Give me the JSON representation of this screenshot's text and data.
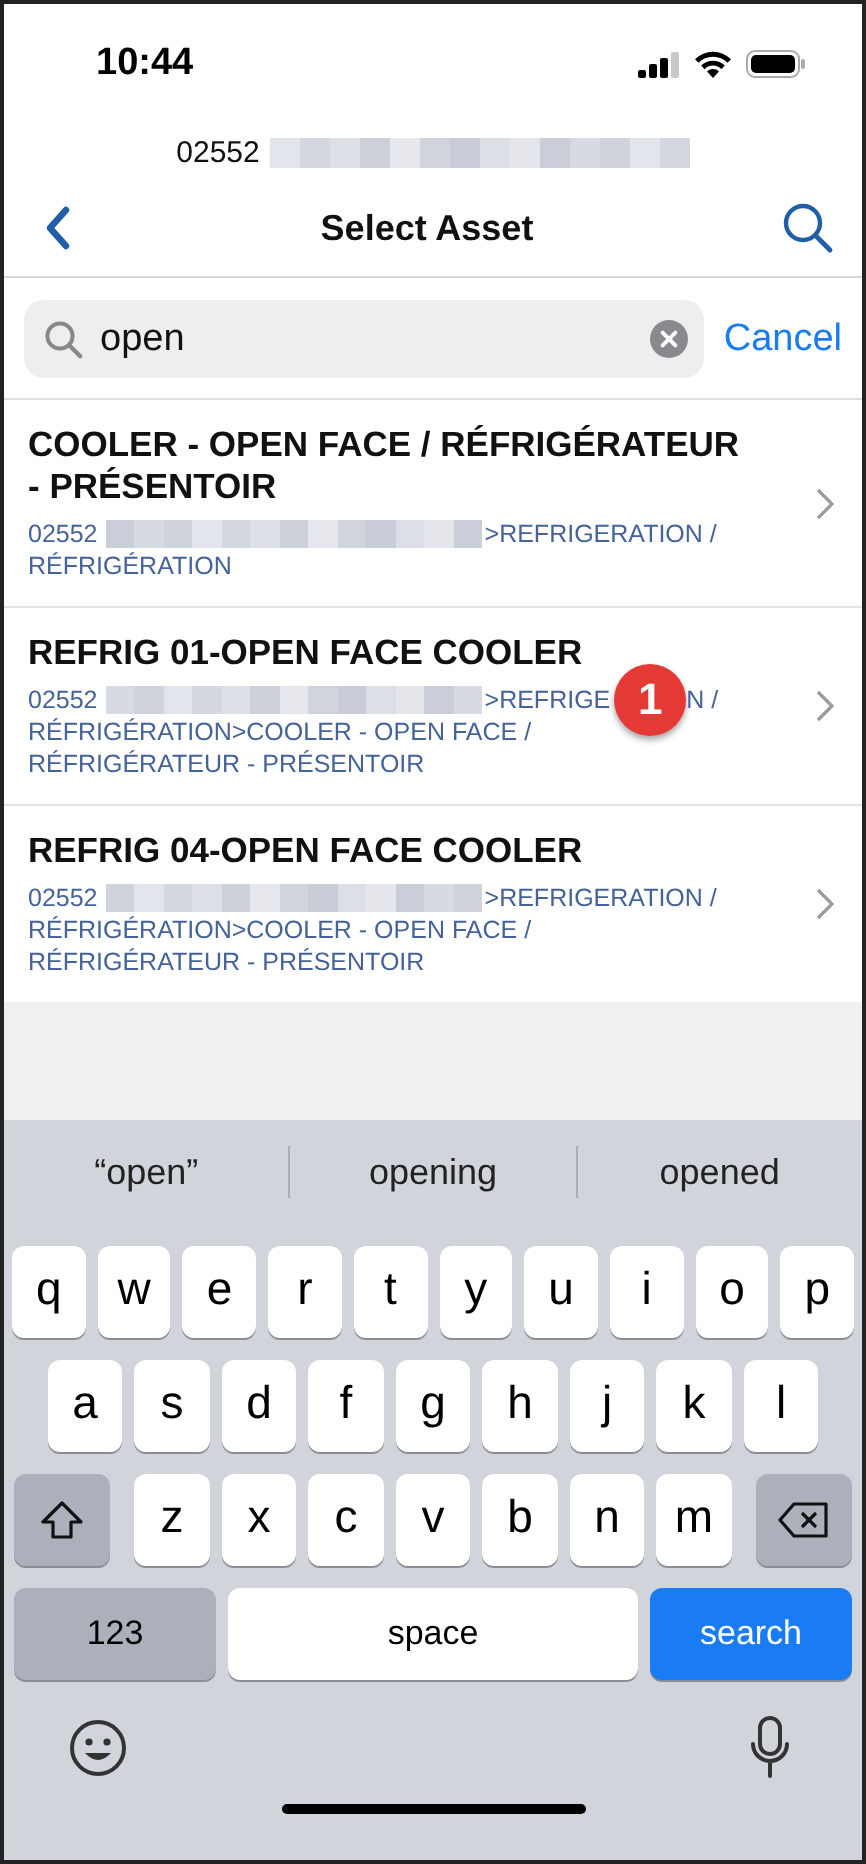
{
  "status_bar": {
    "time": "10:44"
  },
  "header": {
    "subtitle": "02552",
    "title": "Select Asset"
  },
  "search": {
    "value": "open",
    "cancel": "Cancel"
  },
  "assets": [
    {
      "name": "COOLER - OPEN FACE / RÉFRIGÉRATEUR - PRÉSENTOIR",
      "code": "02552",
      "path_lead": ">REFRIGERATION /",
      "path_rest": "RÉFRIGÉRATION"
    },
    {
      "name": "REFRIG 01-OPEN FACE COOLER",
      "code": "02552",
      "path_lead": ">REFRIGE",
      "badge": "1",
      "path_lead_end": "N /",
      "path_rest": "RÉFRIGÉRATION>COOLER - OPEN FACE / RÉFRIGÉRATEUR - PRÉSENTOIR"
    },
    {
      "name": "REFRIG 04-OPEN FACE COOLER",
      "code": "02552",
      "path_lead": ">REFRIGERATION /",
      "path_rest": "RÉFRIGÉRATION>COOLER - OPEN FACE / RÉFRIGÉRATEUR - PRÉSENTOIR"
    }
  ],
  "keyboard": {
    "suggestions": [
      "“open”",
      "opening",
      "opened"
    ],
    "rows": [
      [
        "q",
        "w",
        "e",
        "r",
        "t",
        "y",
        "u",
        "i",
        "o",
        "p"
      ],
      [
        "a",
        "s",
        "d",
        "f",
        "g",
        "h",
        "j",
        "k",
        "l"
      ],
      [
        "z",
        "x",
        "c",
        "v",
        "b",
        "n",
        "m"
      ]
    ],
    "number_key": "123",
    "space_key": "space",
    "search_key": "search"
  }
}
